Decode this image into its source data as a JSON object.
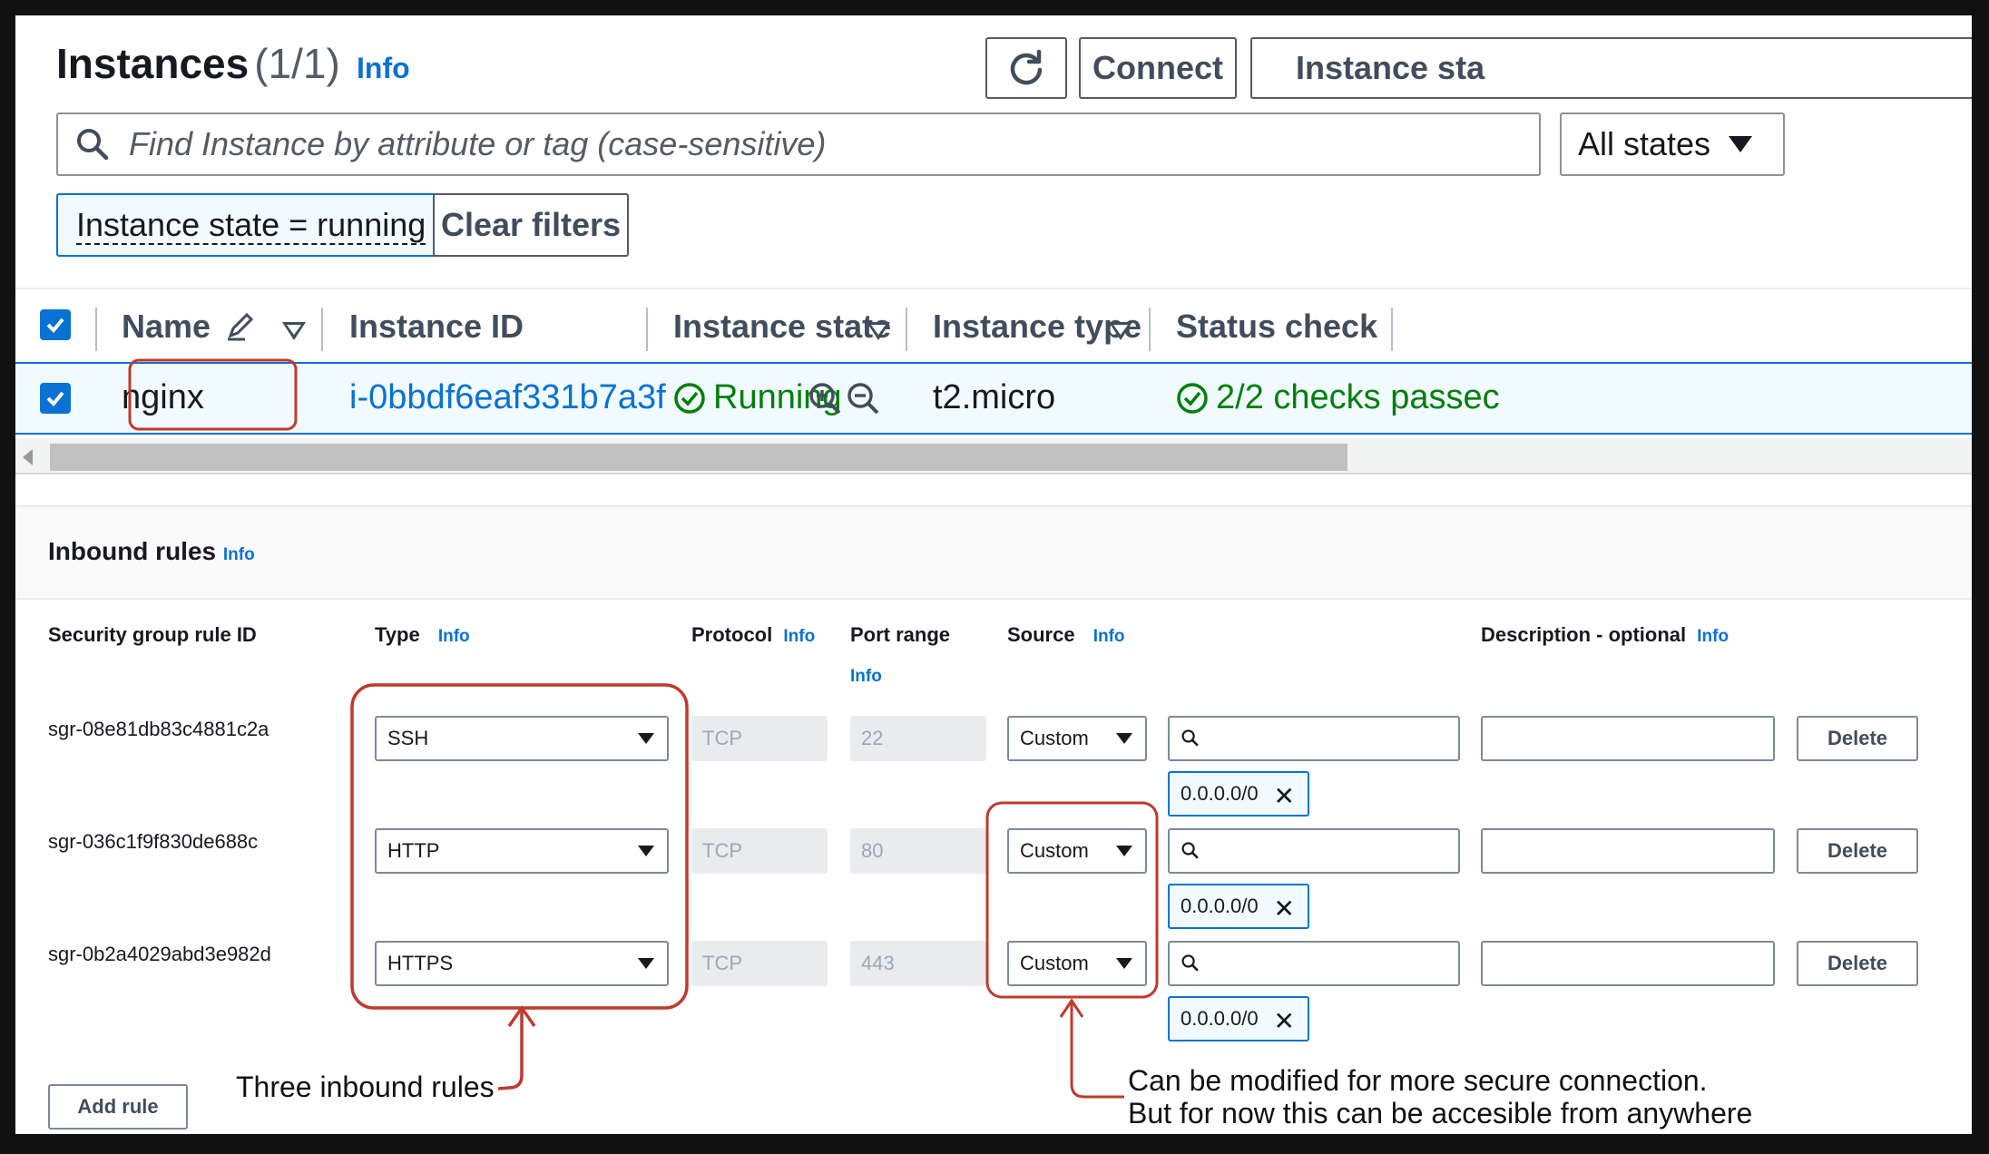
{
  "header": {
    "title": "Instances",
    "count": "(1/1)",
    "info": "Info",
    "refresh_icon": "refresh-icon",
    "connect_label": "Connect",
    "instance_state_label": "Instance sta"
  },
  "search": {
    "placeholder": "Find Instance by attribute or tag (case-sensitive)",
    "states_label": "All states"
  },
  "filter": {
    "token_label": "Instance state = running",
    "clear_label": "Clear filters"
  },
  "table": {
    "columns": [
      "Name",
      "Instance ID",
      "Instance state",
      "Instance type",
      "Status check"
    ],
    "row": {
      "name": "nginx",
      "instance_id": "i-0bbdf6eaf331b7a3f",
      "state": "Running",
      "type": "t2.micro",
      "status_check": "2/2 checks passec"
    }
  },
  "inbound": {
    "title": "Inbound rules",
    "info": "Info",
    "headers": {
      "rule_id": "Security group rule ID",
      "type": "Type",
      "protocol": "Protocol",
      "port_range": "Port range",
      "source": "Source",
      "description": "Description - optional"
    },
    "rules": [
      {
        "id": "sgr-08e81db83c4881c2a",
        "type": "SSH",
        "protocol": "TCP",
        "port": "22",
        "source": "Custom",
        "cidr": "0.0.0.0/0",
        "delete": "Delete"
      },
      {
        "id": "sgr-036c1f9f830de688c",
        "type": "HTTP",
        "protocol": "TCP",
        "port": "80",
        "source": "Custom",
        "cidr": "0.0.0.0/0",
        "delete": "Delete"
      },
      {
        "id": "sgr-0b2a4029abd3e982d",
        "type": "HTTPS",
        "protocol": "TCP",
        "port": "443",
        "source": "Custom",
        "cidr": "0.0.0.0/0",
        "delete": "Delete"
      }
    ],
    "add_rule": "Add rule"
  },
  "annotations": {
    "rules_note": "Three inbound rules",
    "source_note_1": "Can be modified for more secure connection.",
    "source_note_2": "But for now this can be accesible from anywhere"
  },
  "colors": {
    "link": "#0972d3",
    "success": "#037f0c",
    "annotation": "#c0392b"
  }
}
